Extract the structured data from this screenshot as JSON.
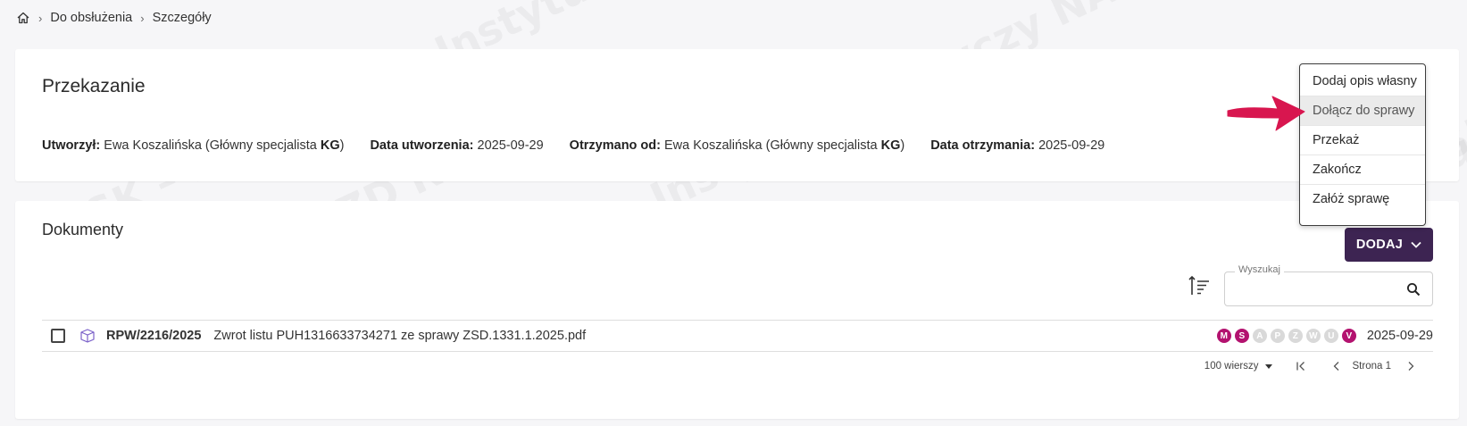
{
  "watermark": {
    "lines": [
      "NASK – Państwowy Instytut Badawczy",
      "EZD RP NASK",
      "Instytut Badawczy NASK",
      "NASK – Państwowy Instytut Badawczy",
      "EZD RP NASK"
    ]
  },
  "breadcrumb": {
    "items": [
      "Do obsłużenia",
      "Szczegóły"
    ],
    "separator": "›"
  },
  "header": {
    "title": "Przekazanie",
    "meta": [
      {
        "label": "Utworzył:",
        "value": "Ewa Koszalińska (Główny specjalista",
        "tag": "KG",
        "suffix": ")"
      },
      {
        "label": "Data utworzenia:",
        "value": "2025-09-29"
      },
      {
        "label": "Otrzymano od:",
        "value": "Ewa Koszalińska (Główny specjalista",
        "tag": "KG",
        "suffix": ")"
      },
      {
        "label": "Data otrzymania:",
        "value": "2025-09-29"
      }
    ]
  },
  "actions_menu": {
    "items": [
      {
        "label": "Dodaj opis własny",
        "active": false
      },
      {
        "label": "Dołącz do sprawy",
        "active": true
      },
      {
        "label": "Przekaż",
        "active": false
      },
      {
        "label": "Zakończ",
        "active": false
      },
      {
        "label": "Załóż sprawę",
        "active": false
      }
    ]
  },
  "documents": {
    "title": "Dokumenty",
    "add_button": "DODAJ",
    "search": {
      "legend": "Wyszukaj",
      "value": "",
      "placeholder": ""
    },
    "rows": [
      {
        "number": "RPW/2216/2025",
        "title": "Zwrot listu PUH1316633734271 ze sprawy ZSD.1331.1.2025.pdf",
        "date": "2025-09-29",
        "badges": [
          {
            "letter": "M",
            "active": true
          },
          {
            "letter": "S",
            "active": true
          },
          {
            "letter": "A",
            "active": false
          },
          {
            "letter": "P",
            "active": false
          },
          {
            "letter": "Z",
            "active": false
          },
          {
            "letter": "W",
            "active": false
          },
          {
            "letter": "U",
            "active": false
          },
          {
            "letter": "V",
            "active": true
          }
        ]
      }
    ],
    "pager": {
      "rows_per_page": "100 wierszy",
      "page_label": "Strona 1"
    }
  },
  "colors": {
    "accent": "#3d2452",
    "badge_active": "#b3126f",
    "badge_inactive": "#d9d9d9",
    "arrow": "#d8164f",
    "doc_icon": "#7b61c9"
  }
}
